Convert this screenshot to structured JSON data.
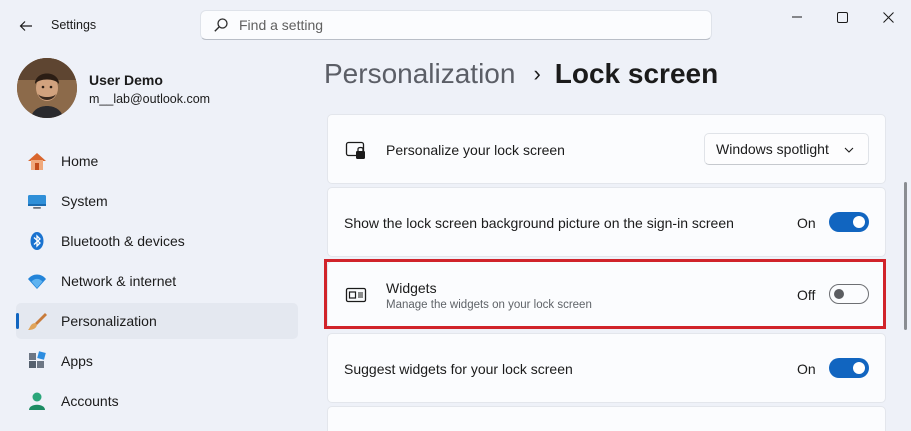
{
  "window": {
    "app_title": "Settings",
    "search_placeholder": "Find a setting"
  },
  "user": {
    "name": "User Demo",
    "email": "m__lab@outlook.com"
  },
  "sidebar": {
    "items": [
      {
        "label": "Home",
        "icon": "home-icon"
      },
      {
        "label": "System",
        "icon": "system-icon"
      },
      {
        "label": "Bluetooth & devices",
        "icon": "bluetooth-icon"
      },
      {
        "label": "Network & internet",
        "icon": "wifi-icon"
      },
      {
        "label": "Personalization",
        "icon": "brush-icon",
        "selected": true
      },
      {
        "label": "Apps",
        "icon": "apps-icon"
      },
      {
        "label": "Accounts",
        "icon": "accounts-icon"
      }
    ]
  },
  "breadcrumb": {
    "parent": "Personalization",
    "separator": "›",
    "current": "Lock screen"
  },
  "settings": {
    "personalize": {
      "title": "Personalize your lock screen",
      "value": "Windows spotlight"
    },
    "background": {
      "title": "Show the lock screen background picture on the sign-in screen",
      "state": "On"
    },
    "widgets": {
      "title": "Widgets",
      "description": "Manage the widgets on your lock screen",
      "state": "Off"
    },
    "suggest": {
      "title": "Suggest widgets for your lock screen",
      "state": "On"
    }
  },
  "colors": {
    "accent": "#1165c0",
    "highlight": "#d1232a"
  }
}
